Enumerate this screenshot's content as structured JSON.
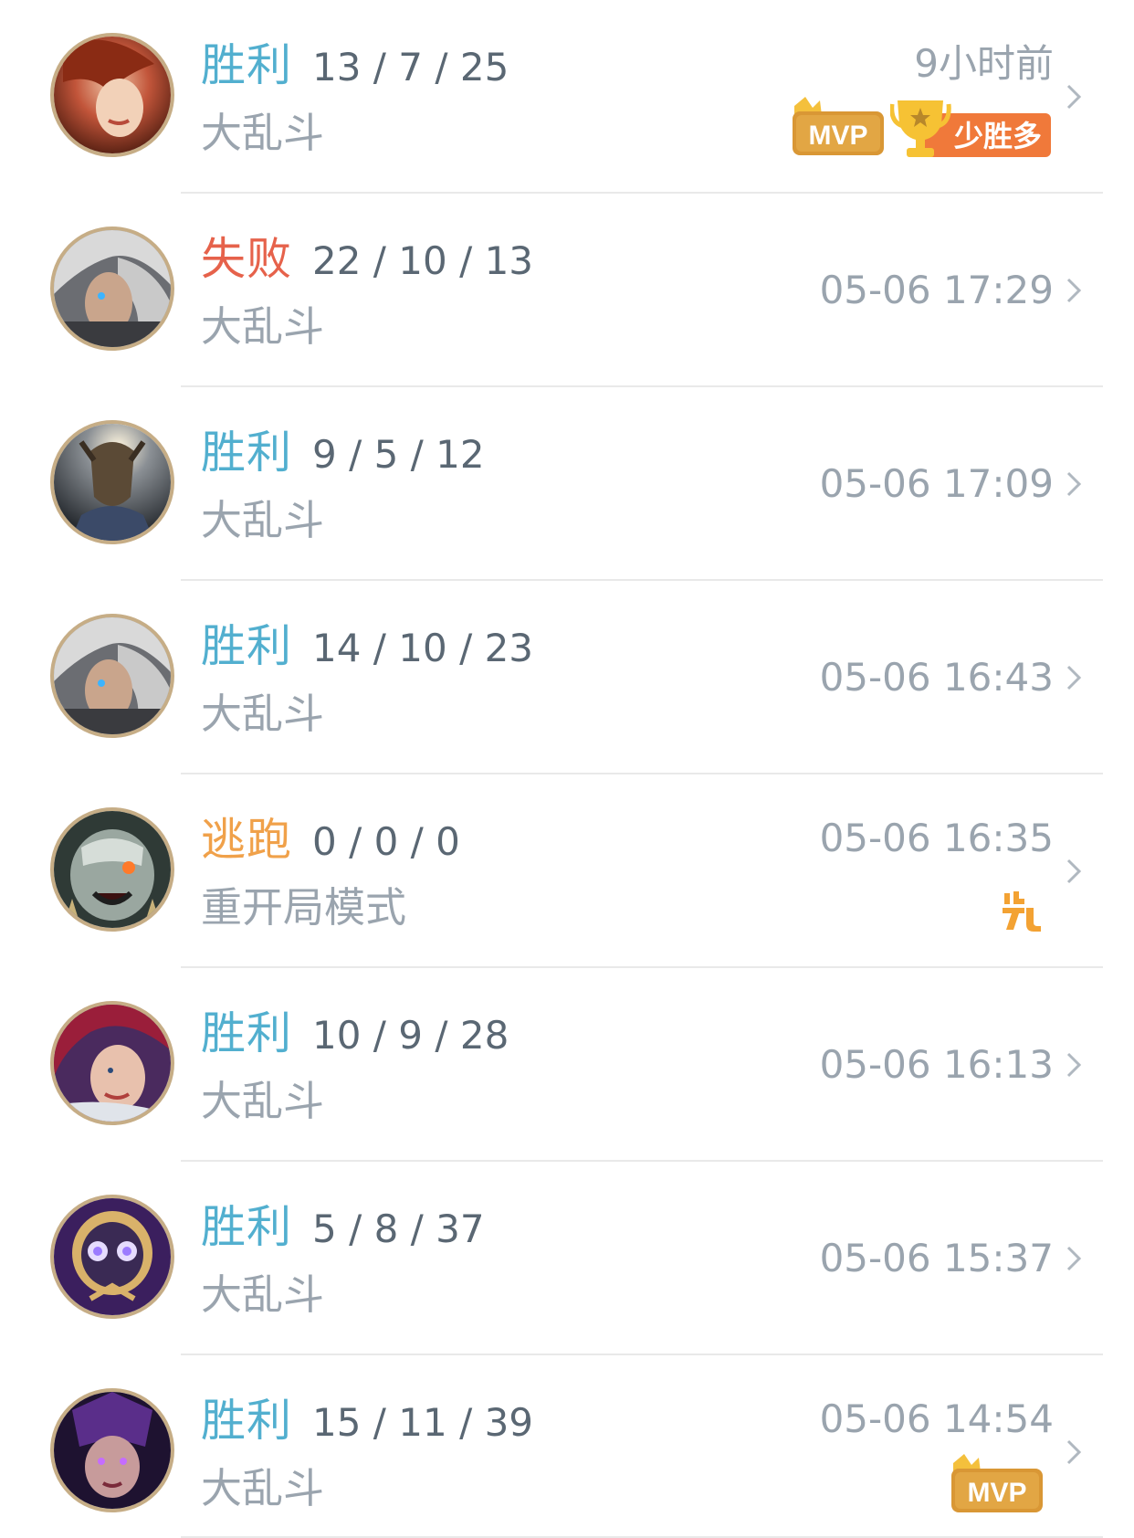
{
  "matches": [
    {
      "result": "胜利",
      "kda": "13 / 7 / 25",
      "mode": "大乱斗",
      "time": "9小时前",
      "badges": [
        "mvp",
        "少胜多"
      ]
    },
    {
      "result": "失败",
      "kda": "22 / 10 / 13",
      "mode": "大乱斗",
      "time": "05-06 17:29",
      "badges": []
    },
    {
      "result": "胜利",
      "kda": "9 / 5 / 12",
      "mode": "大乱斗",
      "time": "05-06 17:09",
      "badges": []
    },
    {
      "result": "胜利",
      "kda": "14 / 10 / 23",
      "mode": "大乱斗",
      "time": "05-06 16:43",
      "badges": []
    },
    {
      "result": "逃跑",
      "kda": "0 / 0 / 0",
      "mode": "重开局模式",
      "time": "05-06 16:35",
      "badges": [
        "escape"
      ]
    },
    {
      "result": "胜利",
      "kda": "10 / 9 / 28",
      "mode": "大乱斗",
      "time": "05-06 16:13",
      "badges": []
    },
    {
      "result": "胜利",
      "kda": "5 / 8 / 37",
      "mode": "大乱斗",
      "time": "05-06 15:37",
      "badges": []
    },
    {
      "result": "胜利",
      "kda": "15 / 11 / 39",
      "mode": "大乱斗",
      "time": "05-06 14:54",
      "badges": [
        "mvp"
      ]
    }
  ],
  "badges": {
    "mvp_label": "MVP",
    "underdog_label": "少胜多"
  },
  "colors": {
    "win": "#52afcf",
    "loss": "#e6624b",
    "escape": "#f0a14a",
    "badge_gold": "#e0a33a",
    "badge_orange": "#f07d35"
  },
  "icons": {
    "chevron": "chevron-right-icon",
    "mvp": "mvp-crown-badge",
    "trophy": "trophy-icon",
    "escape": "escape-run-icon"
  }
}
